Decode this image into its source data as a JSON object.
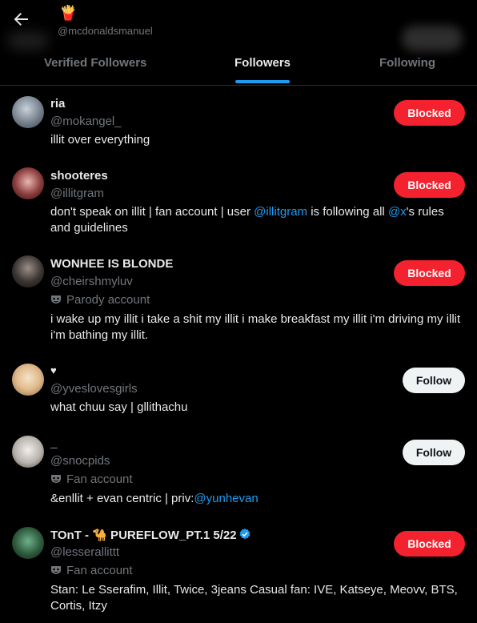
{
  "header": {
    "profile_emoji": "🍟",
    "handle": "@mcdonaldsmanuel"
  },
  "tabs": [
    {
      "label": "Verified Followers"
    },
    {
      "label": "Followers"
    },
    {
      "label": "Following"
    }
  ],
  "users": [
    {
      "name": "ria",
      "handle": "@mokangel_",
      "bio": "illit over everything",
      "button": "Blocked"
    },
    {
      "name": "shooteres",
      "handle": "@illitgram",
      "bio_parts": [
        "don't speak on illit | fan account | user ",
        "@illitgram",
        " is following all ",
        "@x",
        "'s rules and guidelines"
      ],
      "button": "Blocked"
    },
    {
      "name": "WONHEE IS BLONDE",
      "handle": "@cheirshmyluv",
      "badge": "Parody account",
      "bio": "i wake up my illit i take a shit my illit i make breakfast my illit i'm driving my illit i'm bathing my illit.",
      "button": "Blocked"
    },
    {
      "name": "♥",
      "handle": "@yveslovesgirls",
      "bio": "what chuu say | gllithachu",
      "button": "Follow"
    },
    {
      "name": "_",
      "handle": "@snocpids",
      "badge": "Fan account",
      "bio_parts": [
        "&enllit + evan centric | priv:",
        "@yunhevan"
      ],
      "button": "Follow"
    },
    {
      "name": "TOnT - 🐪 PUREFLOW_PT.1 5/22",
      "handle": "@lesserallittt",
      "badge": "Fan account",
      "bio": "Stan: Le Sserafim, Illit, Twice, 3jeans Casual fan: IVE, Katseye, Meovv, BTS, Cortis, Itzy",
      "button": "Blocked"
    }
  ],
  "colors": {
    "accent": "#1d9bf0",
    "blocked": "#f4212e",
    "muted": "#71767b",
    "text": "#e7e9ea"
  }
}
